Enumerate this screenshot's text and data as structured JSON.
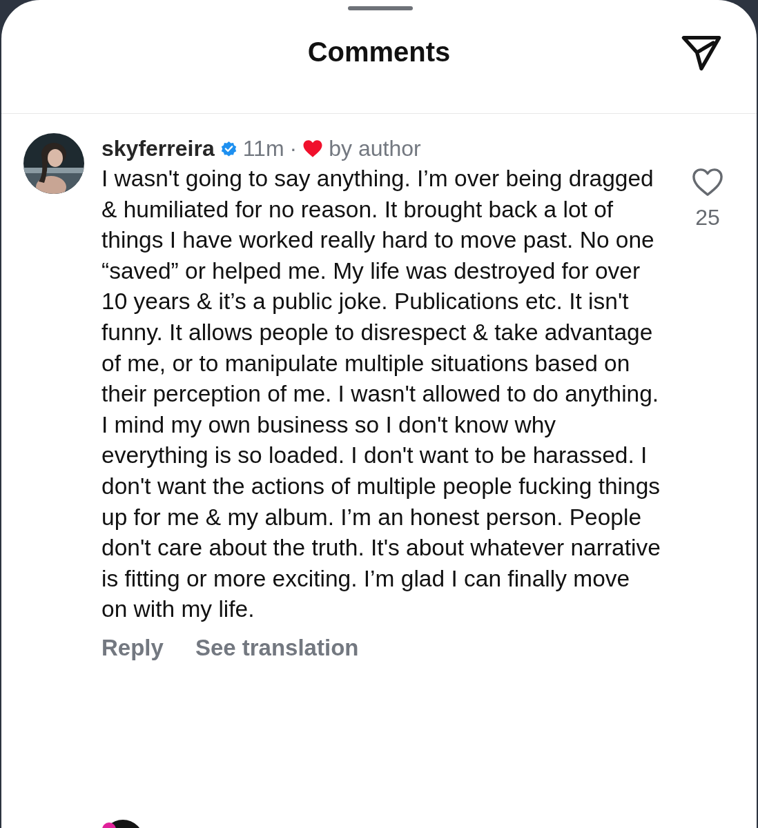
{
  "header": {
    "title": "Comments"
  },
  "comments": [
    {
      "username": "skyferreira",
      "verified": true,
      "time": "11m",
      "separator": "·",
      "author_like": "by author",
      "text": "I wasn't going to say anything. I’m over being dragged & humiliated for no reason. It brought back a lot of things I have worked really hard to move past. No one “saved” or helped me. My life was destroyed for over 10 years & it’s a public joke. Publications etc. It isn't funny. It allows people to disrespect & take advantage of me, or to manipulate multiple situations based on their perception of me. I wasn't allowed to do anything. I mind my own business so I don't know why everything is so loaded. I don't want to be harassed. I don't want the actions of multiple people fucking things up for me & my album. I’m an honest person. People don't care about the truth. It's about whatever narrative is fitting or more exciting. I’m glad I can finally move on with my life.",
      "liked": false,
      "likes": "25",
      "actions": [
        "Reply",
        "See translation"
      ]
    }
  ]
}
